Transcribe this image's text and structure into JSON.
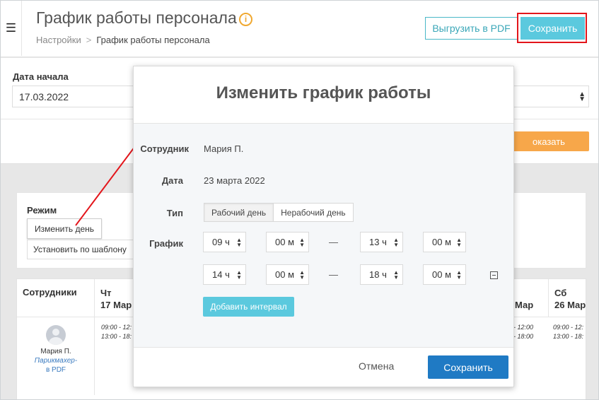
{
  "header": {
    "menu_icon": "hamburger-icon",
    "title": "График работы персонала",
    "info_icon": "info-icon",
    "info_glyph": "i",
    "breadcrumb": {
      "root": "Настройки",
      "separator": ">",
      "current": "График работы персонала"
    },
    "pdf_button": "Выгрузить в PDF",
    "save_button": "Сохранить"
  },
  "filters": {
    "start_label": "Дата начала",
    "start_value": "17.03.2022",
    "show_button": "оказать"
  },
  "mode": {
    "label": "Режим",
    "change_day": "Изменить день",
    "set_template": "Установить по шаблону"
  },
  "schedule": {
    "employees_header": "Сотрудники",
    "days": [
      {
        "day": "Чт",
        "date": "17 Мар"
      },
      {
        "day": "",
        "date": "Мар"
      },
      {
        "day": "Сб",
        "date": "26 Мар"
      }
    ],
    "employee": {
      "name": "Мария П.",
      "role": "Парикмахер-",
      "pdf": "в PDF"
    },
    "times": [
      {
        "line1": "09:00 - 12:",
        "line2": "13:00 - 18:"
      },
      {
        "line1": "- 12:00",
        "line2": "- 18:00"
      },
      {
        "line1": "09:00 - 12:",
        "line2": "13:00 - 18:"
      }
    ]
  },
  "modal": {
    "title": "Изменить график работы",
    "employee_label": "Сотрудник",
    "employee_value": "Мария П.",
    "date_label": "Дата",
    "date_value": "23 марта 2022",
    "type_label": "Тип",
    "type_options": [
      "Рабочий день",
      "Нерабочий день"
    ],
    "type_selected": "Рабочий день",
    "schedule_label": "График",
    "intervals": [
      {
        "from_h": "09 ч",
        "from_m": "00 м",
        "to_h": "13 ч",
        "to_m": "00 м"
      },
      {
        "from_h": "14 ч",
        "from_m": "00 м",
        "to_h": "18 ч",
        "to_m": "00 м"
      }
    ],
    "dash": "—",
    "remove_icon": "minus-square-icon",
    "add_interval": "Добавить интервал",
    "cancel": "Отмена",
    "save": "Сохранить"
  },
  "colors": {
    "accent": "#5bc9de",
    "primary": "#1f7ac4",
    "warning": "#f7a74a",
    "highlight": "#e3151b"
  }
}
